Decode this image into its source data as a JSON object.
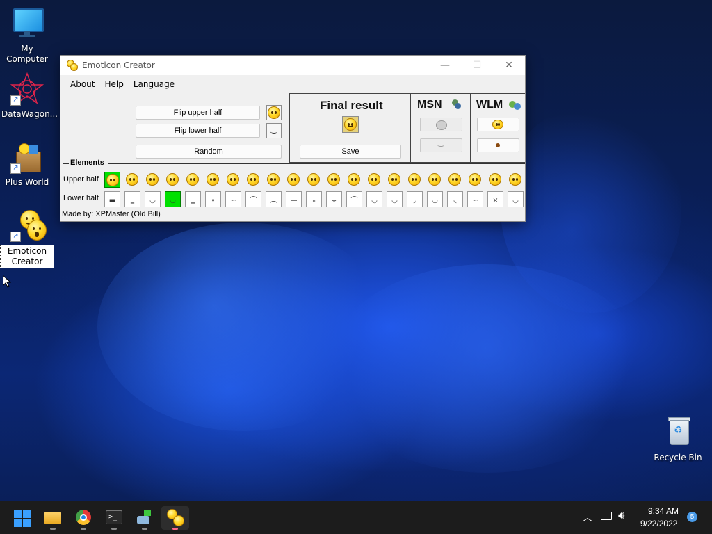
{
  "desktop": {
    "icons": [
      {
        "label": "My Computer"
      },
      {
        "label": "DataWagon..."
      },
      {
        "label": "Plus World"
      },
      {
        "label": "Emoticon Creator"
      },
      {
        "label": "Recycle Bin"
      }
    ]
  },
  "window": {
    "title": "Emoticon Creator",
    "menu": [
      "About",
      "Help",
      "Language"
    ],
    "buttons": {
      "flip_upper": "Flip upper half",
      "flip_lower": "Flip lower half",
      "random": "Random",
      "save": "Save"
    },
    "final_result_title": "Final result",
    "msn_title": "MSN",
    "wlm_title": "WLM",
    "elements_title": "Elements",
    "upper_half_label": "Upper half",
    "lower_half_label": "Lower half",
    "upper_half_count": 21,
    "lower_half_marks": [
      "▬",
      "‗",
      "◡",
      "◡",
      "‗",
      "∘",
      "∽",
      "⌒",
      "︵",
      "—",
      "₀",
      "⌣",
      "⌒",
      "◡",
      "◡",
      "◞",
      "◡",
      "◟",
      "∽",
      "×",
      "◡"
    ],
    "selected_upper_index": 0,
    "selected_lower_index": 3,
    "credit": "Made by: XPMaster (Old Bill)"
  },
  "taskbar": {
    "time": "9:34 AM",
    "date": "9/22/2022",
    "notification_count": "5",
    "apps": [
      "start-icon",
      "file-explorer-icon",
      "chrome-icon",
      "terminal-icon",
      "network-app-icon",
      "emoticon-creator-icon"
    ]
  },
  "colors": {
    "accent": "#1f55e8",
    "selected_cell": "#00e000",
    "smiley": "#ffd92a"
  }
}
